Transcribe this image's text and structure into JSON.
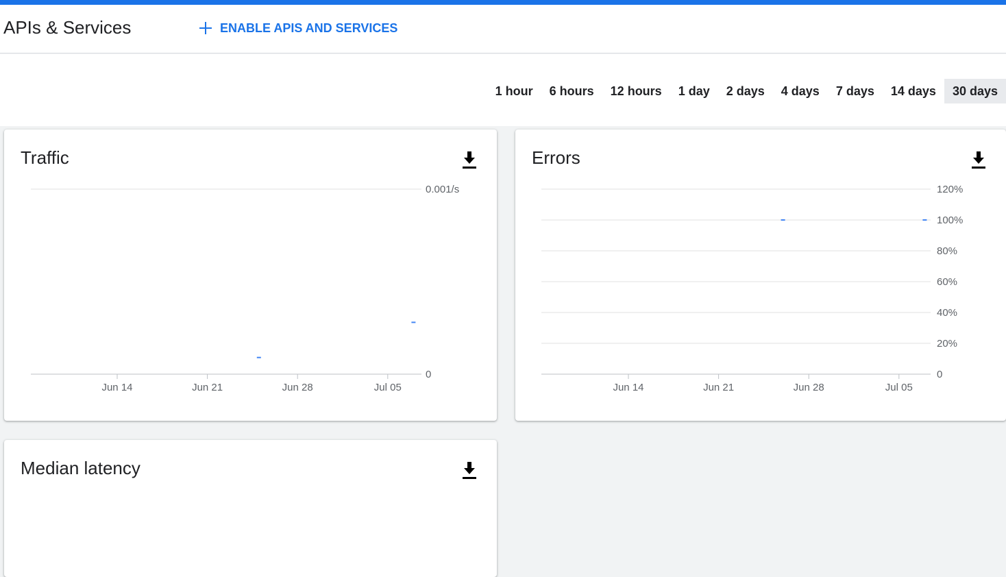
{
  "colors": {
    "accent": "#1a73e8",
    "series": "#4285f4",
    "active_bg": "#e8eaed"
  },
  "header": {
    "title": "APIs & Services",
    "enable_button_label": "ENABLE APIS AND SERVICES",
    "enable_button_icon": "plus-icon"
  },
  "time_range": {
    "options": [
      "1 hour",
      "6 hours",
      "12 hours",
      "1 day",
      "2 days",
      "4 days",
      "7 days",
      "14 days",
      "30 days"
    ],
    "selected": "30 days"
  },
  "cards": {
    "traffic": {
      "title": "Traffic",
      "download_icon": "download-icon"
    },
    "errors": {
      "title": "Errors",
      "download_icon": "download-icon"
    },
    "median_latency": {
      "title": "Median latency",
      "download_icon": "download-icon"
    }
  },
  "chart_data": [
    {
      "type": "line",
      "title": "Traffic",
      "x_ticks": [
        "Jun 14",
        "Jun 21",
        "Jun 28",
        "Jul 05"
      ],
      "y_ticks": [
        "0.001/s",
        "0"
      ],
      "ylim": [
        0,
        0.001
      ],
      "grid": true,
      "series": [
        {
          "points": [
            {
              "x": "Jun 25",
              "y": 9e-05
            },
            {
              "x": "Jul 07",
              "y": 0.00028
            }
          ]
        }
      ]
    },
    {
      "type": "line",
      "title": "Errors",
      "x_ticks": [
        "Jun 14",
        "Jun 21",
        "Jun 28",
        "Jul 05"
      ],
      "y_ticks": [
        "120%",
        "100%",
        "80%",
        "60%",
        "40%",
        "20%",
        "0"
      ],
      "ylim": [
        0,
        120
      ],
      "grid": true,
      "series": [
        {
          "points": [
            {
              "x": "Jun 26",
              "y": 100
            },
            {
              "x": "Jul 07",
              "y": 100
            }
          ]
        }
      ]
    }
  ]
}
